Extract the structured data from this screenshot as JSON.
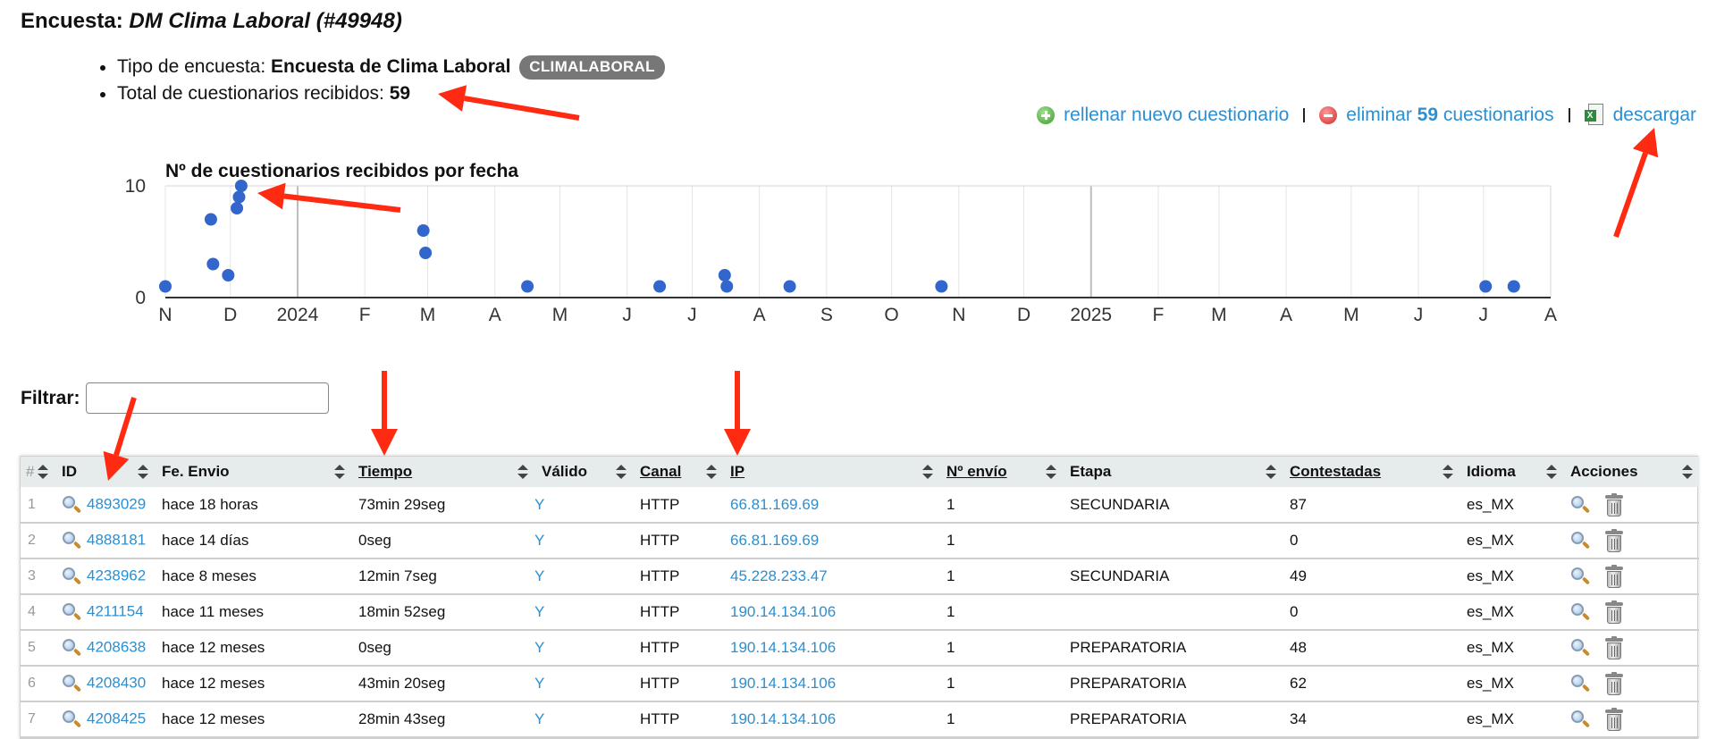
{
  "header": {
    "prefix": "Encuesta:",
    "survey_name": "DM Clima Laboral (#49948)"
  },
  "info": {
    "type_label": "Tipo de encuesta:",
    "type_value": "Encuesta de Clima Laboral",
    "type_badge": "CLIMALABORAL",
    "total_label": "Total de cuestionarios recibidos:",
    "total_value": "59"
  },
  "actions": {
    "fill_new": "rellenar nuevo cuestionario",
    "delete_prefix": "eliminar",
    "delete_count": "59",
    "delete_suffix": "cuestionarios",
    "download": "descargar",
    "fill_icon": "plus-circle-icon",
    "delete_icon": "minus-circle-icon",
    "download_icon": "excel-file-icon"
  },
  "chart_data": {
    "type": "scatter",
    "title": "Nº de cuestionarios recibidos por fecha",
    "x_range": [
      "2023-11-01",
      "2025-08-01"
    ],
    "ylim": [
      0,
      10
    ],
    "y_ticks": [
      0,
      10
    ],
    "x_tick_labels": [
      "N",
      "D",
      "2024",
      "F",
      "M",
      "A",
      "M",
      "J",
      "J",
      "A",
      "S",
      "O",
      "N",
      "D",
      "2025",
      "F",
      "M",
      "A",
      "M",
      "J",
      "J",
      "A"
    ],
    "points": [
      {
        "x": "2023-11-01",
        "y": 1
      },
      {
        "x": "2023-11-22",
        "y": 7
      },
      {
        "x": "2023-11-23",
        "y": 3
      },
      {
        "x": "2023-11-30",
        "y": 2
      },
      {
        "x": "2023-12-04",
        "y": 8
      },
      {
        "x": "2023-12-05",
        "y": 9
      },
      {
        "x": "2023-12-06",
        "y": 10
      },
      {
        "x": "2024-02-28",
        "y": 6
      },
      {
        "x": "2024-02-29",
        "y": 4
      },
      {
        "x": "2024-04-16",
        "y": 1
      },
      {
        "x": "2024-06-16",
        "y": 1
      },
      {
        "x": "2024-07-16",
        "y": 2
      },
      {
        "x": "2024-07-17",
        "y": 1
      },
      {
        "x": "2024-08-15",
        "y": 1
      },
      {
        "x": "2024-10-24",
        "y": 1
      },
      {
        "x": "2025-07-02",
        "y": 1
      },
      {
        "x": "2025-07-15",
        "y": 1
      }
    ],
    "color": "#3366cc"
  },
  "filter": {
    "label": "Filtrar:",
    "value": "",
    "placeholder": ""
  },
  "table": {
    "columns": [
      "#",
      "ID",
      "Fe. Envio",
      "Tiempo",
      "Válido",
      "Canal",
      "IP",
      "Nº envío",
      "Etapa",
      "Contestadas",
      "Idioma",
      "Acciones"
    ],
    "rows": [
      {
        "n": "1",
        "id": "4893029",
        "fecha": "hace 18 horas",
        "tiempo": "73min 29seg",
        "valido": "Y",
        "canal": "HTTP",
        "ip": "66.81.169.69",
        "envio": "1",
        "etapa": "SECUNDARIA",
        "contestadas": "87",
        "idioma": "es_MX"
      },
      {
        "n": "2",
        "id": "4888181",
        "fecha": "hace 14 días",
        "tiempo": "0seg",
        "valido": "Y",
        "canal": "HTTP",
        "ip": "66.81.169.69",
        "envio": "1",
        "etapa": "",
        "contestadas": "0",
        "idioma": "es_MX"
      },
      {
        "n": "3",
        "id": "4238962",
        "fecha": "hace 8 meses",
        "tiempo": "12min 7seg",
        "valido": "Y",
        "canal": "HTTP",
        "ip": "45.228.233.47",
        "envio": "1",
        "etapa": "SECUNDARIA",
        "contestadas": "49",
        "idioma": "es_MX"
      },
      {
        "n": "4",
        "id": "4211154",
        "fecha": "hace 11 meses",
        "tiempo": "18min 52seg",
        "valido": "Y",
        "canal": "HTTP",
        "ip": "190.14.134.106",
        "envio": "1",
        "etapa": "",
        "contestadas": "0",
        "idioma": "es_MX"
      },
      {
        "n": "5",
        "id": "4208638",
        "fecha": "hace 12 meses",
        "tiempo": "0seg",
        "valido": "Y",
        "canal": "HTTP",
        "ip": "190.14.134.106",
        "envio": "1",
        "etapa": "PREPARATORIA",
        "contestadas": "48",
        "idioma": "es_MX"
      },
      {
        "n": "6",
        "id": "4208430",
        "fecha": "hace 12 meses",
        "tiempo": "43min 20seg",
        "valido": "Y",
        "canal": "HTTP",
        "ip": "190.14.134.106",
        "envio": "1",
        "etapa": "PREPARATORIA",
        "contestadas": "62",
        "idioma": "es_MX"
      },
      {
        "n": "7",
        "id": "4208425",
        "fecha": "hace 12 meses",
        "tiempo": "28min 43seg",
        "valido": "Y",
        "canal": "HTTP",
        "ip": "190.14.134.106",
        "envio": "1",
        "etapa": "PREPARATORIA",
        "contestadas": "34",
        "idioma": "es_MX"
      }
    ]
  },
  "annotation_color": "#ff2a12"
}
